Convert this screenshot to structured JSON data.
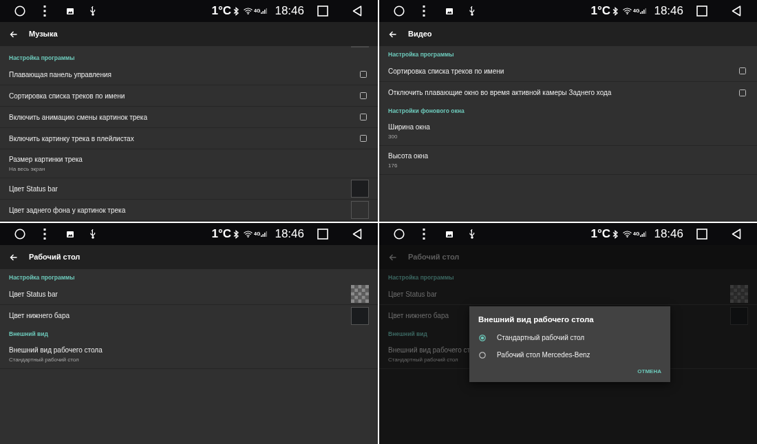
{
  "panels": [
    {
      "status_bar": {
        "temperature": "1°C",
        "network": "4G",
        "time": "18:46"
      },
      "title": "Музыка",
      "dimmed": false,
      "scroll_indicator": true,
      "items": [
        {
          "kind": "section",
          "label": "Настройка программы"
        },
        {
          "kind": "checkbox",
          "label": "Плавающая панель управления",
          "checked": false
        },
        {
          "kind": "checkbox",
          "label": "Сортировка списка треков по имени",
          "checked": false
        },
        {
          "kind": "checkbox",
          "label": "Включить анимацию смены картинок трека",
          "checked": false
        },
        {
          "kind": "checkbox",
          "label": "Включить картинку трека в плейлистах",
          "checked": false
        },
        {
          "kind": "summary",
          "label": "Размер картинки трека",
          "summary": "На весь экран"
        },
        {
          "kind": "swatch",
          "label": "Цвет Status bar",
          "color": "#1c1d1f"
        },
        {
          "kind": "swatch",
          "label": "Цвет заднего фона у картинок трека",
          "color": "#303030"
        }
      ]
    },
    {
      "status_bar": {
        "temperature": "1°C",
        "network": "4G",
        "time": "18:46"
      },
      "title": "Видео",
      "dimmed": false,
      "scroll_indicator": false,
      "items": [
        {
          "kind": "section",
          "label": "Настройка программы"
        },
        {
          "kind": "checkbox",
          "label": "Сортировка списка треков по имени",
          "checked": false
        },
        {
          "kind": "checkbox",
          "label": "Отключить плавающие окно во время активной камеры Заднего хода",
          "checked": false
        },
        {
          "kind": "section",
          "label": "Настройки фонового окна"
        },
        {
          "kind": "summary",
          "label": "Ширина окна",
          "summary": "300"
        },
        {
          "kind": "summary",
          "label": "Высота окна",
          "summary": "176"
        }
      ]
    },
    {
      "status_bar": {
        "temperature": "1°C",
        "network": "4G",
        "time": "18:46"
      },
      "title": "Рабочий стол",
      "dimmed": false,
      "scroll_indicator": false,
      "items": [
        {
          "kind": "section",
          "label": "Настройка программы"
        },
        {
          "kind": "transparent_swatch",
          "label": "Цвет Status bar"
        },
        {
          "kind": "swatch",
          "label": "Цвет нижнего бара",
          "color": "#1a1c1e"
        },
        {
          "kind": "section",
          "label": "Внешний вид"
        },
        {
          "kind": "summary",
          "label": "Внешний вид рабочего стола",
          "summary": "Стандартный рабочий стол"
        }
      ]
    },
    {
      "status_bar": {
        "temperature": "1°C",
        "network": "4G",
        "time": "18:46"
      },
      "title": "Рабочий стол",
      "dimmed": true,
      "scroll_indicator": false,
      "items": [
        {
          "kind": "section",
          "label": "Настройка программы"
        },
        {
          "kind": "transparent_swatch",
          "label": "Цвет Status bar"
        },
        {
          "kind": "swatch",
          "label": "Цвет нижнего бара",
          "color": "#0e0f10"
        },
        {
          "kind": "section",
          "label": "Внешний вид"
        },
        {
          "kind": "summary",
          "label": "Внешний вид рабочего ст",
          "summary": "Стандартный рабочий стол"
        }
      ],
      "dialog": {
        "title": "Внешний вид рабочего стола",
        "options": [
          {
            "label": "Стандартный рабочий стол",
            "selected": true
          },
          {
            "label": "Рабочий стол Mercedes-Benz",
            "selected": false
          }
        ],
        "button": "ОТМЕНА"
      }
    }
  ]
}
